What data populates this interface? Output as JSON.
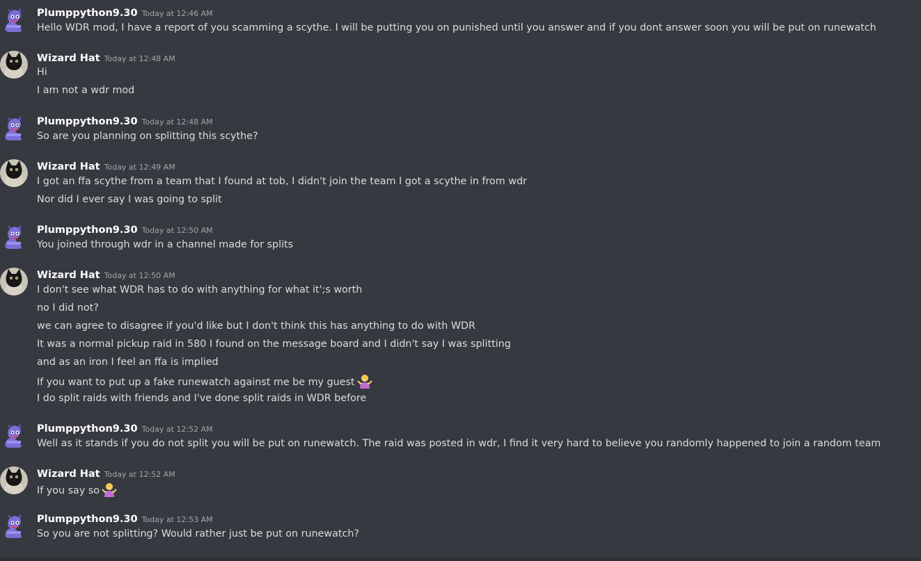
{
  "messages": [
    {
      "author": "Plumppython9.30",
      "timestamp": "Today at 12:46 AM",
      "avatar_icon": "purple-python-icon",
      "lines": [
        "Hello WDR mod, I have a report of you scamming a scythe. I will be putting you on punished until you answer and if you dont answer soon you will be put on runewatch"
      ]
    },
    {
      "author": "Wizard Hat",
      "timestamp": "Today at 12:48 AM",
      "avatar_icon": "black-cat-icon",
      "lines": [
        "Hi",
        "I am not a wdr mod"
      ]
    },
    {
      "author": "Plumppython9.30",
      "timestamp": "Today at 12:48 AM",
      "avatar_icon": "purple-python-icon",
      "lines": [
        "So are you planning on splitting this scythe?"
      ]
    },
    {
      "author": "Wizard Hat",
      "timestamp": "Today at 12:49 AM",
      "avatar_icon": "black-cat-icon",
      "lines": [
        "I got an ffa scythe from a team that I found at tob, I didn't join the team I got a scythe in from wdr",
        "Nor did I ever say I was going to split"
      ]
    },
    {
      "author": "Plumppython9.30",
      "timestamp": "Today at 12:50 AM",
      "avatar_icon": "purple-python-icon",
      "lines": [
        "You joined through wdr in a channel made for splits"
      ]
    },
    {
      "author": "Wizard Hat",
      "timestamp": "Today at 12:50 AM",
      "avatar_icon": "black-cat-icon",
      "lines": [
        "I don't see what WDR has to do with anything for what it';s worth",
        "no I did not?",
        "we can agree to disagree if you'd like but I don't think this has anything to do with WDR",
        "It was a normal pickup raid in 580 I found on the message board and I didn't say I was splitting",
        "and as an iron I feel an ffa is implied",
        "If you want to put up a fake runewatch against me be my guest",
        "I do split raids with friends and I've done split raids in WDR before"
      ]
    },
    {
      "author": "Plumppython9.30",
      "timestamp": "Today at 12:52 AM",
      "avatar_icon": "purple-python-icon",
      "lines": [
        "Well as it stands if you do not split you will be put on runewatch. The raid was posted in wdr, I find it very hard to believe you randomly happened to join a random team"
      ]
    },
    {
      "author": "Wizard Hat",
      "timestamp": "Today at 12:52 AM",
      "avatar_icon": "black-cat-icon",
      "lines": [
        "If you say so"
      ]
    },
    {
      "author": "Plumppython9.30",
      "timestamp": "Today at 12:53 AM",
      "avatar_icon": "purple-python-icon",
      "lines": [
        "So you are not splitting? Would rather just be put on runewatch?"
      ]
    }
  ],
  "emoji": {
    "shrug": "person-shrugging-emoji"
  },
  "colors": {
    "background": "#36393f",
    "username": "#ffffff",
    "timestamp": "#a3a6aa",
    "message_text": "#dcddde"
  }
}
